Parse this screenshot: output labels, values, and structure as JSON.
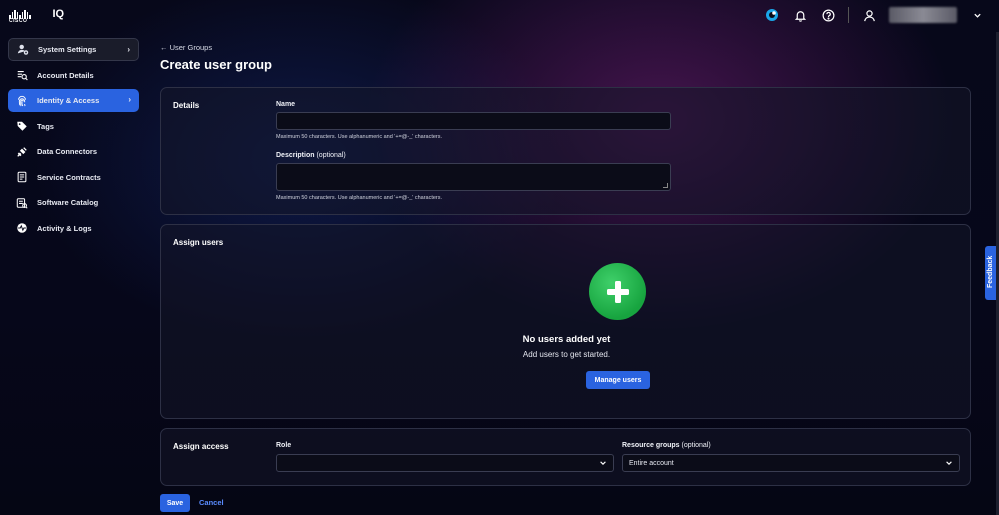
{
  "brand": {
    "company": "CISCO",
    "product": "IQ"
  },
  "colors": {
    "accent": "#2a63e0",
    "success": "#1fb24a",
    "link": "#5a8cff"
  },
  "header_icons": [
    "cisco-iq-assistant-icon",
    "bell-icon",
    "help-icon",
    "user-icon",
    "chevron-down-icon"
  ],
  "sidebar": {
    "items": [
      {
        "label": "System Settings",
        "icon": "user-gear-icon"
      },
      {
        "label": "Account Details",
        "icon": "document-search-icon"
      },
      {
        "label": "Identity & Access",
        "icon": "fingerprint-icon"
      },
      {
        "label": "Tags",
        "icon": "tag-icon"
      },
      {
        "label": "Data Connectors",
        "icon": "plug-icon"
      },
      {
        "label": "Service Contracts",
        "icon": "contract-icon"
      },
      {
        "label": "Software Catalog",
        "icon": "catalog-icon"
      },
      {
        "label": "Activity & Logs",
        "icon": "activity-icon"
      }
    ]
  },
  "breadcrumb": {
    "back_label": "User Groups"
  },
  "page": {
    "title": "Create user group"
  },
  "details": {
    "section_title": "Details",
    "name_label": "Name",
    "name_value": "",
    "name_hint": "Maximum 50 characters. Use alphanumeric and '+=@-_' characters.",
    "description_label": "Description",
    "description_optional": "(optional)",
    "description_value": "",
    "description_hint": "Maximum 50 characters. Use alphanumeric and '+=@-_' characters."
  },
  "assign_users": {
    "section_title": "Assign users",
    "empty_title": "No users added yet",
    "empty_subtitle": "Add users to get started.",
    "manage_button": "Manage users"
  },
  "assign_access": {
    "section_title": "Assign access",
    "role_label": "Role",
    "role_value": "",
    "resource_label": "Resource groups",
    "resource_optional": "(optional)",
    "resource_value": "Entire account"
  },
  "actions": {
    "save": "Save",
    "cancel": "Cancel"
  },
  "feedback": {
    "label": "Feedback"
  }
}
